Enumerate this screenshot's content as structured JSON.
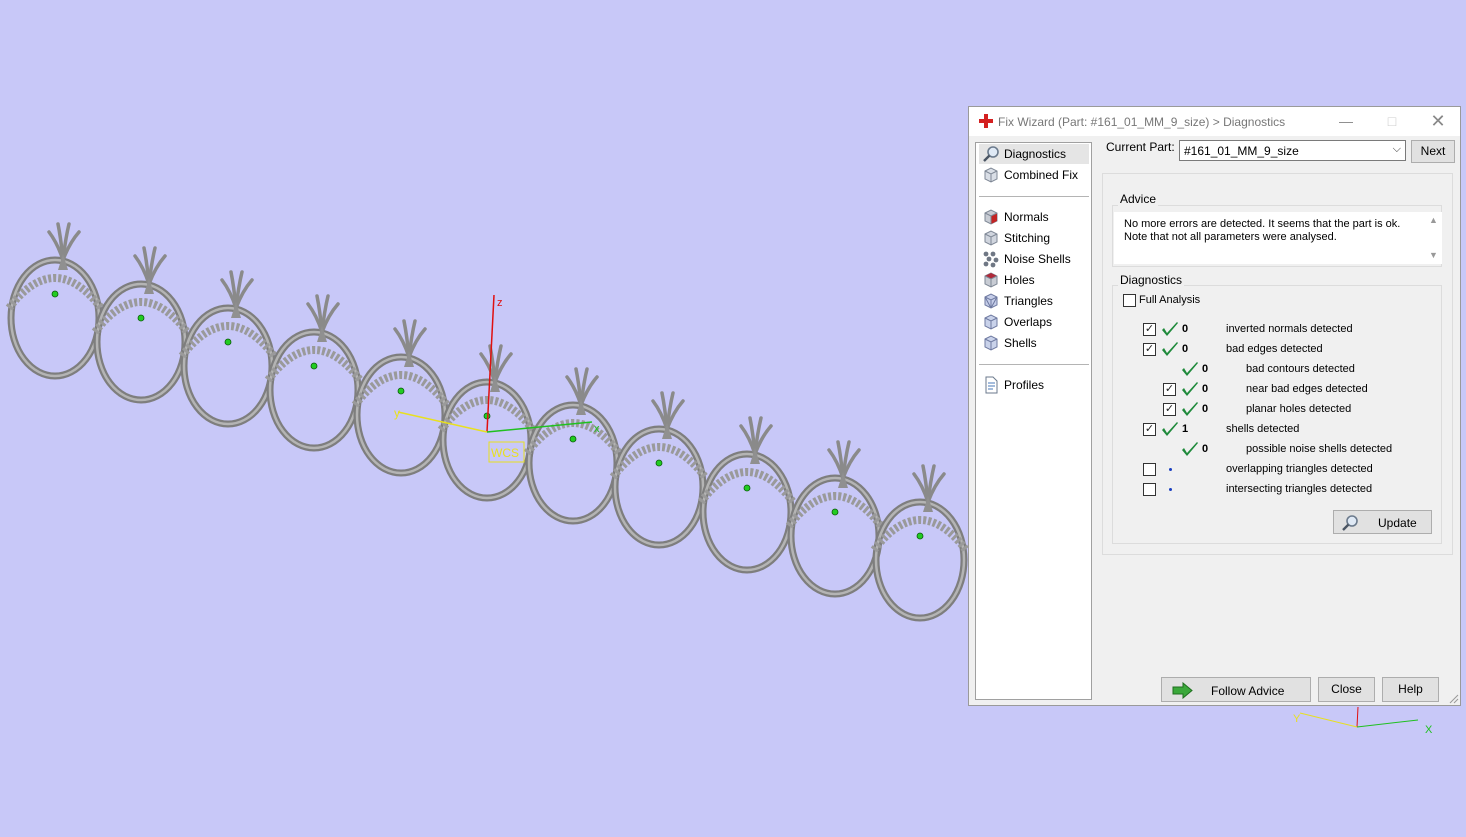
{
  "viewport": {
    "background": "#c8c8f8",
    "axis_labels": {
      "x": "x",
      "y": "y",
      "z": "z",
      "wcs": "WCS"
    },
    "mini_axis_labels": {
      "x": "X",
      "y": "Y"
    }
  },
  "window": {
    "title": "Fix Wizard (Part: #161_01_MM_9_size) > Diagnostics",
    "title_icon": "red-cross-icon",
    "controls": [
      "minimize",
      "maximize",
      "close"
    ]
  },
  "nav": {
    "items": [
      {
        "label": "Diagnostics",
        "icon": "magnifier-icon",
        "selected": true
      },
      {
        "label": "Combined Fix",
        "icon": "cube-icon"
      },
      {
        "label": "Normals",
        "icon": "normals-cube-icon"
      },
      {
        "label": "Stitching",
        "icon": "stitching-cube-icon"
      },
      {
        "label": "Noise Shells",
        "icon": "noise-shells-icon"
      },
      {
        "label": "Holes",
        "icon": "holes-cube-icon"
      },
      {
        "label": "Triangles",
        "icon": "triangles-cube-icon"
      },
      {
        "label": "Overlaps",
        "icon": "overlaps-cube-icon"
      },
      {
        "label": "Shells",
        "icon": "shells-cube-icon"
      },
      {
        "label": "Profiles",
        "icon": "profile-document-icon"
      }
    ]
  },
  "current_part": {
    "label": "Current Part:",
    "value": "#161_01_MM_9_size",
    "next_label": "Next"
  },
  "advice": {
    "legend": "Advice",
    "text": "No more errors are detected. It seems that the part is ok.\nNote that not all parameters were analysed."
  },
  "diagnostics": {
    "legend": "Diagnostics",
    "full_analysis_label": "Full Analysis",
    "full_analysis_checked": false,
    "rows": [
      {
        "checked": true,
        "status": "ok",
        "count": "0",
        "text": "inverted normals detected",
        "indent": 0
      },
      {
        "checked": true,
        "status": "ok",
        "count": "0",
        "text": "bad edges detected",
        "indent": 0
      },
      {
        "checked": null,
        "status": "ok",
        "count": "0",
        "text": "bad contours detected",
        "indent": 1
      },
      {
        "checked": true,
        "status": "ok",
        "count": "0",
        "text": "near bad edges detected",
        "indent": 1
      },
      {
        "checked": true,
        "status": "ok",
        "count": "0",
        "text": "planar holes detected",
        "indent": 1
      },
      {
        "checked": true,
        "status": "ok",
        "count": "1",
        "text": "shells detected",
        "indent": 0
      },
      {
        "checked": null,
        "status": "ok",
        "count": "0",
        "text": "possible noise shells detected",
        "indent": 1
      },
      {
        "checked": false,
        "status": "pending",
        "count": "",
        "text": "overlapping triangles detected",
        "indent": 0
      },
      {
        "checked": false,
        "status": "pending",
        "count": "",
        "text": "intersecting triangles detected",
        "indent": 0
      }
    ],
    "update_label": "Update"
  },
  "footer": {
    "follow_advice_label": "Follow Advice",
    "close_label": "Close",
    "help_label": "Help"
  },
  "colors": {
    "ok_tick": "#1f8a3b",
    "pending_dot": "#1a3fc0",
    "title_icon": "#d42020",
    "follow_arrow": "#3aa83a"
  }
}
